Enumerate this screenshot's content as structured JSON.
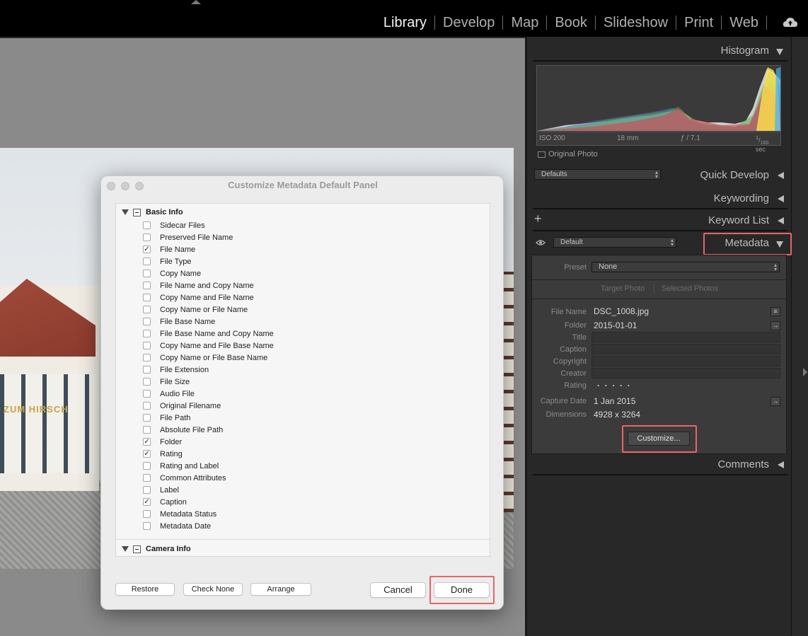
{
  "modules": [
    "Library",
    "Develop",
    "Map",
    "Book",
    "Slideshow",
    "Print",
    "Web"
  ],
  "active_module": "Library",
  "photo_sign": "ZUM HIRSCH",
  "panels": {
    "histogram": "Histogram",
    "quick_develop": "Quick Develop",
    "keywording": "Keywording",
    "keyword_list": "Keyword List",
    "metadata": "Metadata",
    "comments": "Comments"
  },
  "histogram_info": {
    "iso": "ISO 200",
    "focal": "18 mm",
    "aperture": "ƒ / 7.1",
    "shutter_num": "1",
    "shutter_den": "160",
    "shutter_unit": "sec",
    "original_photo": "Original Photo"
  },
  "quick_develop_preset": "Defaults",
  "keyword_add": "+",
  "metadata_preset_left": "Default",
  "metadata": {
    "preset_label": "Preset",
    "preset_value": "None",
    "target_photo": "Target Photo",
    "selected_photos": "Selected Photos",
    "file_name_label": "File Name",
    "file_name": "DSC_1008.jpg",
    "folder_label": "Folder",
    "folder": "2015-01-01",
    "title_label": "Title",
    "caption_label": "Caption",
    "copyright_label": "Copyright",
    "creator_label": "Creator",
    "rating_label": "Rating",
    "rating": ". . . . .",
    "capture_date_label": "Capture Date",
    "capture_date": "1 Jan 2015",
    "dimensions_label": "Dimensions",
    "dimensions": "4928 x 3264",
    "customize_button": "Customize..."
  },
  "dialog": {
    "title": "Customize Metadata Default Panel",
    "group1": "Basic Info",
    "group2": "Camera Info",
    "items": [
      {
        "label": "Sidecar Files",
        "checked": false
      },
      {
        "label": "Preserved File Name",
        "checked": false
      },
      {
        "label": "File Name",
        "checked": true
      },
      {
        "label": "File Type",
        "checked": false
      },
      {
        "label": "Copy Name",
        "checked": false
      },
      {
        "label": "File Name and Copy Name",
        "checked": false
      },
      {
        "label": "Copy Name and File Name",
        "checked": false
      },
      {
        "label": "Copy Name or File Name",
        "checked": false
      },
      {
        "label": "File Base Name",
        "checked": false
      },
      {
        "label": "File Base Name and Copy Name",
        "checked": false
      },
      {
        "label": "Copy Name and File Base Name",
        "checked": false
      },
      {
        "label": "Copy Name or File Base Name",
        "checked": false
      },
      {
        "label": "File Extension",
        "checked": false
      },
      {
        "label": "File Size",
        "checked": false
      },
      {
        "label": "Audio File",
        "checked": false
      },
      {
        "label": "Original Filename",
        "checked": false
      },
      {
        "label": "File Path",
        "checked": false
      },
      {
        "label": "Absolute File Path",
        "checked": false
      },
      {
        "label": "Folder",
        "checked": true
      },
      {
        "label": "Rating",
        "checked": true
      },
      {
        "label": "Rating and Label",
        "checked": false
      },
      {
        "label": "Common Attributes",
        "checked": false
      },
      {
        "label": "Label",
        "checked": false
      },
      {
        "label": "Caption",
        "checked": true
      },
      {
        "label": "Metadata Status",
        "checked": false
      },
      {
        "label": "Metadata Date",
        "checked": false
      }
    ],
    "restore": "Restore",
    "check_none": "Check None",
    "arrange": "Arrange",
    "cancel": "Cancel",
    "done": "Done"
  },
  "highlight_color": "#e8646a"
}
